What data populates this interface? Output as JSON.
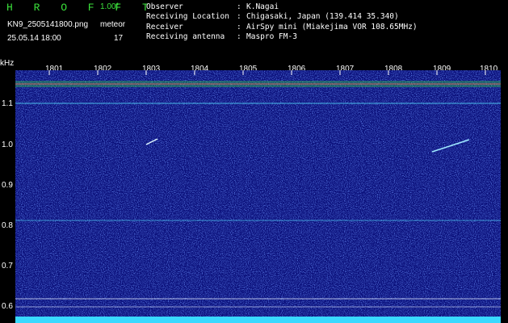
{
  "header": {
    "logo": "H R O F F T",
    "version": "1.00f",
    "filename": "KN9_2505141800.png",
    "mode": "meteor",
    "datetime": "25.05.14 18:00",
    "count": "17"
  },
  "info": [
    {
      "key": "Observer",
      "value": "K.Nagai"
    },
    {
      "key": "Receiving Location",
      "value": "Chigasaki, Japan (139.414 35.340)"
    },
    {
      "key": "Receiver",
      "value": "AirSpy mini (Miakejima VOR 108.65MHz)"
    },
    {
      "key": "Receiving antenna",
      "value": "Maspro FM-3"
    }
  ],
  "axes": {
    "unit": "kHz",
    "x_ticks": [
      "1801",
      "1802",
      "1803",
      "1804",
      "1805",
      "1806",
      "1807",
      "1808",
      "1809",
      "1810"
    ],
    "y_ticks": [
      "1.1",
      "1.0",
      "0.9",
      "0.8",
      "0.7",
      "0.6"
    ]
  },
  "colors": {
    "background": "#0a0f7a",
    "trace": "#3be23b",
    "line_cyan": "#54e0ff",
    "line_red": "#ff5060"
  }
}
